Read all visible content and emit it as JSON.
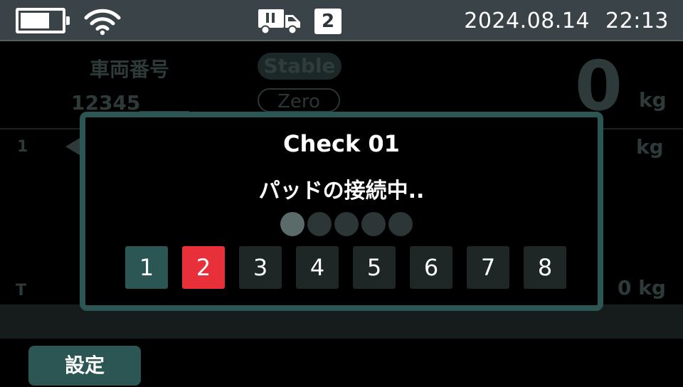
{
  "statusbar": {
    "battery_level": 0.72,
    "truck_count": "2",
    "date": "2024.08.14",
    "time": "22:13"
  },
  "background": {
    "vehicle_label": "車両番号",
    "vehicle_number": "12345",
    "stable_label": "Stable",
    "zero_label": "Zero",
    "weight_value": "0",
    "weight_unit": "kg",
    "row_index": "1",
    "row_unit": "kg",
    "tare_label": "T",
    "tare_value": "0 kg"
  },
  "modal": {
    "title": "Check 01",
    "message": "パッドの接続中..",
    "progress": {
      "total": 5,
      "active": 1
    },
    "pads": [
      {
        "label": "1",
        "state": "connected"
      },
      {
        "label": "2",
        "state": "error"
      },
      {
        "label": "3",
        "state": "idle"
      },
      {
        "label": "4",
        "state": "idle"
      },
      {
        "label": "5",
        "state": "idle"
      },
      {
        "label": "6",
        "state": "idle"
      },
      {
        "label": "7",
        "state": "idle"
      },
      {
        "label": "8",
        "state": "idle"
      }
    ]
  },
  "footer": {
    "settings_label": "設定"
  },
  "colors": {
    "accent": "#2b5653",
    "error": "#e8303a",
    "statusbar": "#3a4448"
  },
  "icons": [
    "battery-icon",
    "wifi-icon",
    "truck-icon"
  ]
}
